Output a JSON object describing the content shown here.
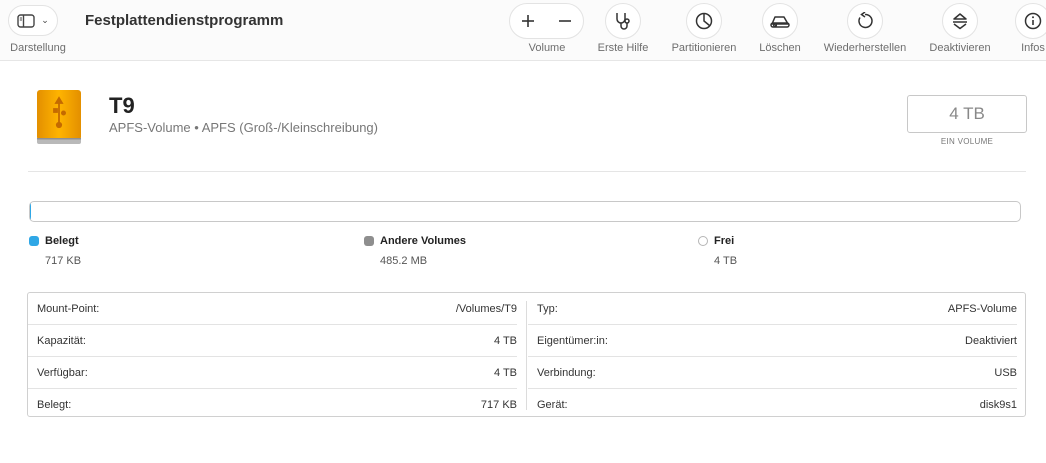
{
  "toolbar": {
    "title": "Festplattendienstprogramm",
    "darstellung_label": "Darstellung",
    "volume_label": "Volume",
    "erste_hilfe_label": "Erste Hilfe",
    "partitionieren_label": "Partitionieren",
    "loeschen_label": "Löschen",
    "wiederherstellen_label": "Wiederherstellen",
    "deaktivieren_label": "Deaktivieren",
    "infos_label": "Infos"
  },
  "volume": {
    "name": "T9",
    "subtitle": "APFS-Volume • APFS (Groß-/Kleinschreibung)",
    "size": "4 TB",
    "size_caption": "EIN VOLUME"
  },
  "usage": {
    "used_fraction": 0.0001,
    "legend": [
      {
        "title": "Belegt",
        "value": "717 KB",
        "color": "#2fa7e6"
      },
      {
        "title": "Andere Volumes",
        "value": "485.2 MB",
        "color": "#8e8e8e"
      },
      {
        "title": "Frei",
        "value": "4 TB",
        "color": "#ffffff"
      }
    ]
  },
  "info": {
    "left": [
      {
        "key": "Mount-Point:",
        "value": "/Volumes/T9"
      },
      {
        "key": "Kapazität:",
        "value": "4 TB"
      },
      {
        "key": "Verfügbar:",
        "value": "4 TB"
      },
      {
        "key": "Belegt:",
        "value": "717 KB"
      }
    ],
    "right": [
      {
        "key": "Typ:",
        "value": "APFS-Volume"
      },
      {
        "key": "Eigentümer:in:",
        "value": "Deaktiviert"
      },
      {
        "key": "Verbindung:",
        "value": "USB"
      },
      {
        "key": "Gerät:",
        "value": "disk9s1"
      }
    ]
  },
  "colors": {
    "disk_orange": "#f4a100",
    "used_blue": "#2fa7e6",
    "other_gray": "#8e8e8e"
  },
  "icons": [
    "sidebar-icon",
    "plus-icon",
    "minus-icon",
    "stethoscope-icon",
    "pie-chart-icon",
    "eraser-icon",
    "restore-icon",
    "unmount-icon",
    "info-icon",
    "external-drive-icon"
  ]
}
